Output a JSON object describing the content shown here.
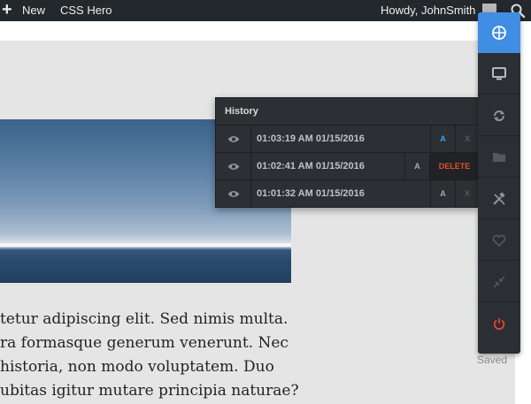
{
  "adminbar": {
    "plus_icon": "plus-icon",
    "new_label": "New",
    "csshero_label": "CSS Hero",
    "howdy_label": "Howdy, JohnSmith",
    "search_icon": "search-icon"
  },
  "content": {
    "paragraph_lines": [
      "tetur adipiscing elit. Sed nimis multa.",
      "ra formasque generum venerunt. Nec",
      " historia, non modo voluptatem. Duo",
      "ubitas igitur mutare principia naturae?"
    ]
  },
  "history": {
    "title": "History",
    "rows": [
      {
        "time": "01:03:19 AM 01/15/2016",
        "a_label": "A",
        "x_label": "X",
        "active": true
      },
      {
        "time": "01:02:41 AM 01/15/2016",
        "a_label": "A",
        "delete_label": "DELETE"
      },
      {
        "time": "01:01:32 AM 01/15/2016",
        "a_label": "A",
        "x_label": "X"
      }
    ]
  },
  "toolbar": {
    "items": [
      "crosshair-icon",
      "monitor-icon",
      "refresh-icon",
      "folder-icon",
      "tools-icon",
      "heart-icon",
      "collapse-icon",
      "power-icon"
    ],
    "accent_color": "#3f8ee4",
    "power_color": "#e5432f"
  },
  "status": {
    "saved_label": "Saved"
  }
}
